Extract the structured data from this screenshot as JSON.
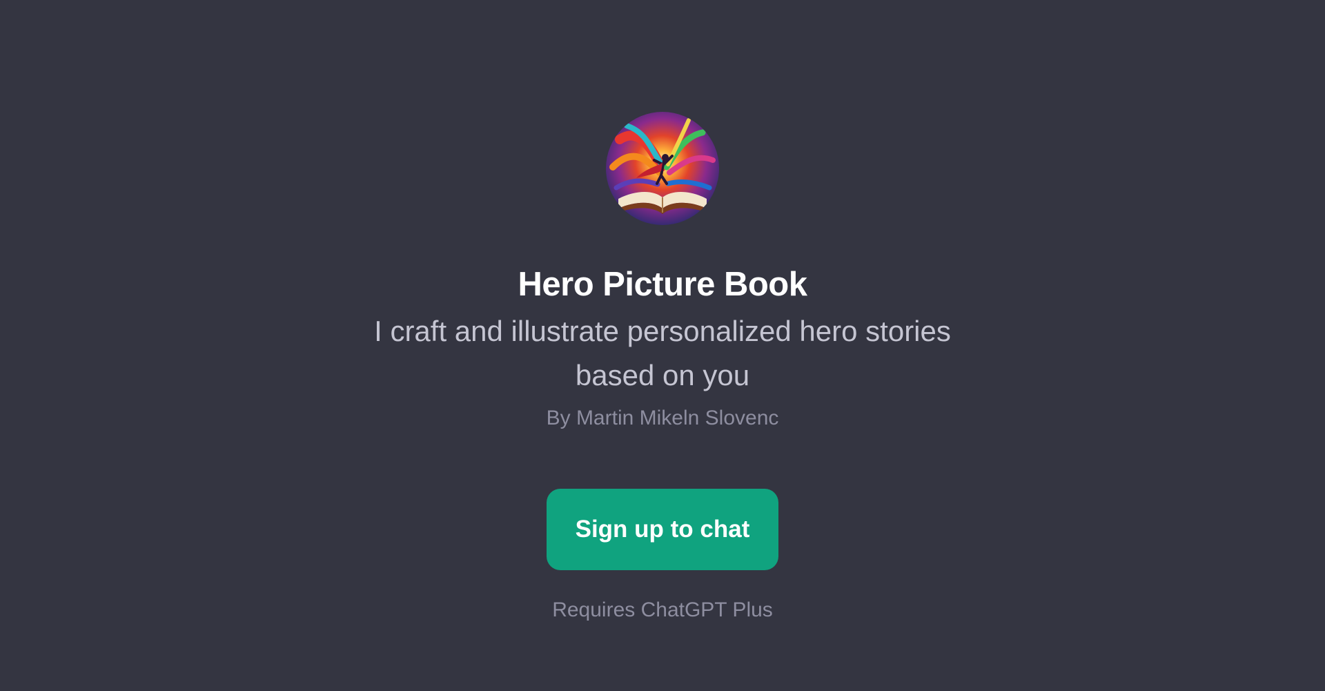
{
  "gpt": {
    "avatar_icon": "open-book-hero-illustration",
    "title": "Hero Picture Book",
    "description": "I craft and illustrate personalized hero stories based on you",
    "author": "By Martin Mikeln Slovenc"
  },
  "cta": {
    "label": "Sign up to chat",
    "color": "#10a37f"
  },
  "requirement": "Requires ChatGPT Plus",
  "colors": {
    "background": "#343541",
    "title": "#ffffff",
    "description": "#c5c5d2",
    "muted": "#8e8ea0"
  }
}
